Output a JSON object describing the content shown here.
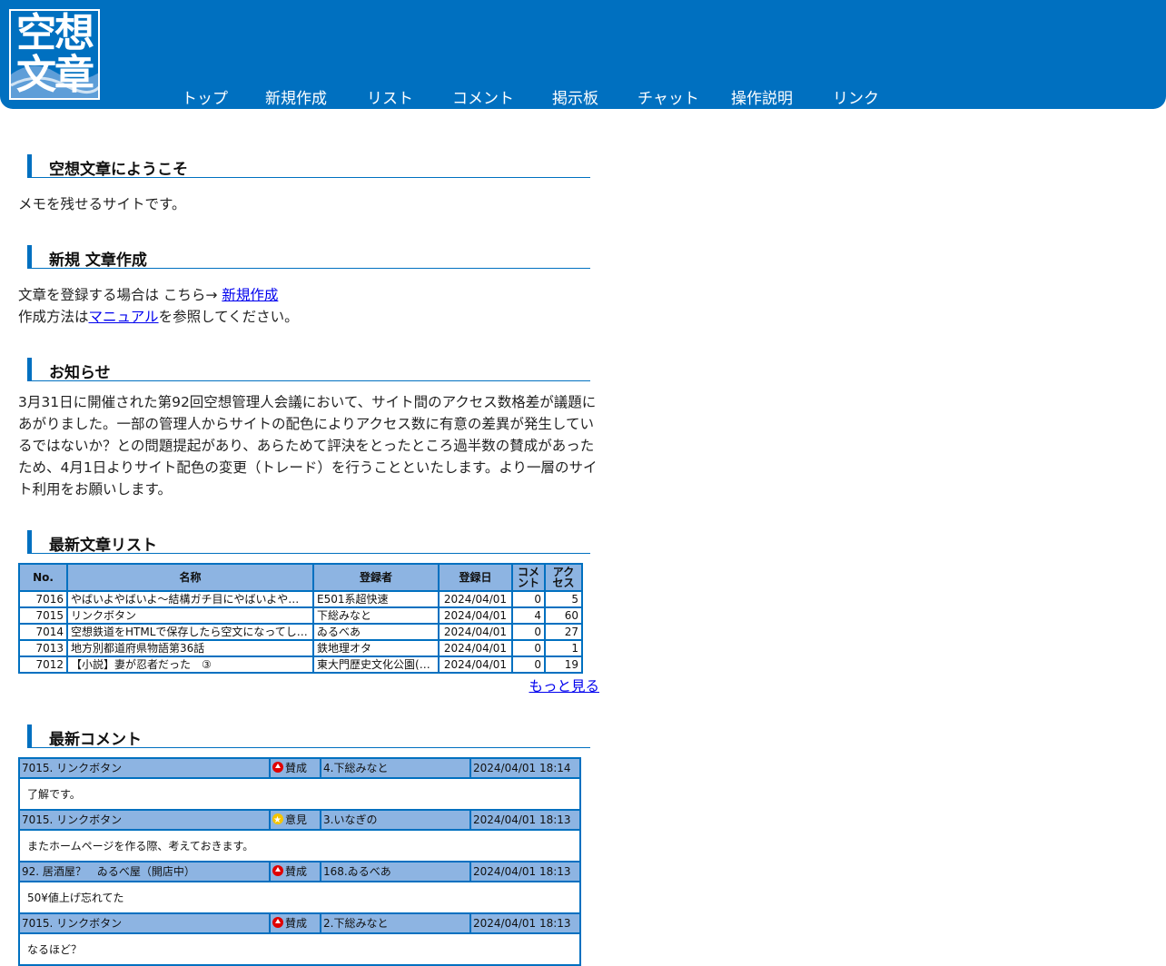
{
  "logo": {
    "line1": "空想",
    "line2": "文章"
  },
  "nav": [
    {
      "label": "トップ"
    },
    {
      "label": "新規作成"
    },
    {
      "label": "リスト"
    },
    {
      "label": "コメント"
    },
    {
      "label": "掲示板"
    },
    {
      "label": "チャット"
    },
    {
      "label": "操作説明"
    },
    {
      "label": "リンク"
    }
  ],
  "welcome": {
    "title": "空想文章にようこそ",
    "text": "メモを残せるサイトです。"
  },
  "create": {
    "title": "新規 文章作成",
    "line1_prefix": "文章を登録する場合は こちら→ ",
    "line1_link": "新規作成",
    "line2_prefix": "作成方法は",
    "line2_link": "マニュアル",
    "line2_suffix": "を参照してください。"
  },
  "notice": {
    "title": "お知らせ",
    "text": "3月31日に開催された第92回空想管理人会議において、サイト間のアクセス数格差が議題にあがりました。一部の管理人からサイトの配色によりアクセス数に有意の差異が発生しているではないか？との問題提起があり、あらためて評決をとったところ過半数の賛成があったため、4月1日よりサイト配色の変更（トレード）を行うことといたします。より一層のサイト利用をお願いします。"
  },
  "articles": {
    "title": "最新文章リスト",
    "headers": {
      "no": "No.",
      "name": "名称",
      "author": "登録者",
      "date": "登録日",
      "comment": "コメント",
      "access": "アクセス"
    },
    "rows": [
      {
        "no": "7016",
        "name": "やばいよやばいよ～結構ガチ目にやばいよやばいよ",
        "author": "E501系超快速",
        "date": "2024/04/01",
        "comment": "0",
        "access": "5"
      },
      {
        "no": "7015",
        "name": "リンクボタン",
        "author": "下総みなと",
        "date": "2024/04/01",
        "comment": "4",
        "access": "60"
      },
      {
        "no": "7014",
        "name": "空想鉄道をHTMLで保存したら空文になってしまった",
        "author": "ゐるべあ",
        "date": "2024/04/01",
        "comment": "0",
        "access": "27"
      },
      {
        "no": "7013",
        "name": "地方別都道府県物語第36話",
        "author": "鉄地理オタ",
        "date": "2024/04/01",
        "comment": "0",
        "access": "1"
      },
      {
        "no": "7012",
        "name": "【小説】妻が忍者だった　③",
        "author": "東大門歴史文化公園(DDP)",
        "date": "2024/04/01",
        "comment": "0",
        "access": "19"
      }
    ],
    "more": "もっと見る"
  },
  "comments": {
    "title": "最新コメント",
    "items": [
      {
        "article": "7015. リンクボタン",
        "vote": "賛成",
        "vote_icon": "up-arrow-icon",
        "user": "4.下総みなと",
        "datetime": "2024/04/01 18:14",
        "body": "了解です。"
      },
      {
        "article": "7015. リンクボタン",
        "vote": "意見",
        "vote_icon": "star-icon",
        "user": "3.いなぎの",
        "datetime": "2024/04/01 18:13",
        "body": "またホームページを作る際、考えておきます。"
      },
      {
        "article": "92. 居酒屋？　ゐるべ屋（開店中）",
        "vote": "賛成",
        "vote_icon": "up-arrow-icon",
        "user": "168.ゐるべあ",
        "datetime": "2024/04/01 18:13",
        "body": "50¥値上げ忘れてた"
      },
      {
        "article": "7015. リンクボタン",
        "vote": "賛成",
        "vote_icon": "up-arrow-icon",
        "user": "2.下総みなと",
        "datetime": "2024/04/01 18:13",
        "body": "なるほど？"
      }
    ]
  },
  "colors": {
    "brand": "#0070c0",
    "table_header": "#8db4e2",
    "link": "#0000ee"
  }
}
